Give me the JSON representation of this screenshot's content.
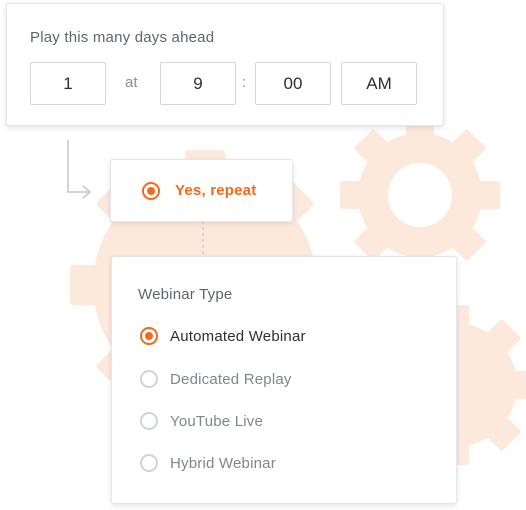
{
  "schedule": {
    "label": "Play this many days ahead",
    "days": "1",
    "at_text": "at",
    "hour": "9",
    "colon": ":",
    "minute": "00",
    "period": "AM"
  },
  "repeat": {
    "label": "Yes, repeat",
    "selected": true
  },
  "webinar_type": {
    "label": "Webinar Type",
    "options": [
      {
        "label": "Automated Webinar",
        "selected": true
      },
      {
        "label": "Dedicated Replay",
        "selected": false
      },
      {
        "label": "YouTube Live",
        "selected": false
      },
      {
        "label": "Hybrid Webinar",
        "selected": false
      }
    ]
  },
  "colors": {
    "accent": "#f26a1c",
    "gear": "#fde8dc",
    "text": "#2b2f33",
    "muted": "#7f868d"
  }
}
